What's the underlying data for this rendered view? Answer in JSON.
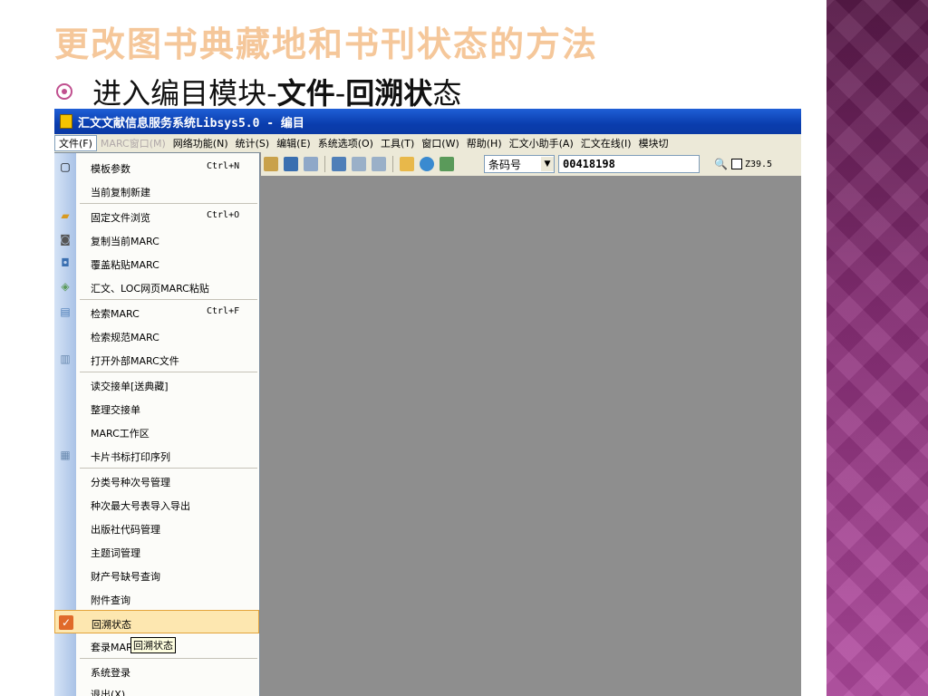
{
  "slide": {
    "title": "更改图书典藏地和书刊状态的方法",
    "bullet_prefix": "进入编目模块-",
    "bullet_bold1": "文件",
    "bullet_dash": "-",
    "bullet_bold2": "回溯状",
    "bullet_suffix": "态"
  },
  "window": {
    "title": "汇文文献信息服务系统Libsys5.0 - 编目"
  },
  "menubar": [
    "文件(F)",
    "MARC窗口(M)",
    "网络功能(N)",
    "统计(S)",
    "编辑(E)",
    "系统选项(O)",
    "工具(T)",
    "窗口(W)",
    "帮助(H)",
    "汇文小助手(A)",
    "汇文在线(I)",
    "模块切"
  ],
  "toolbar": {
    "search_type": "条码号",
    "search_value": "00418198",
    "z_label": "Z39.5"
  },
  "file_menu": [
    {
      "label": "模板参数",
      "shortcut": "Ctrl+N"
    },
    {
      "label": "当前复制新建",
      "shortcut": ""
    },
    {
      "label": "固定文件浏览",
      "shortcut": "Ctrl+O"
    },
    {
      "label": "复制当前MARC",
      "shortcut": ""
    },
    {
      "label": "覆盖粘贴MARC",
      "shortcut": ""
    },
    {
      "label": "汇文、LOC网页MARC粘贴",
      "shortcut": ""
    },
    {
      "label": "检索MARC",
      "shortcut": "Ctrl+F"
    },
    {
      "label": "检索规范MARC",
      "shortcut": ""
    },
    {
      "label": "打开外部MARC文件",
      "shortcut": ""
    },
    {
      "label": "读交接单[送典藏]",
      "shortcut": ""
    },
    {
      "label": "整理交接单",
      "shortcut": ""
    },
    {
      "label": "MARC工作区",
      "shortcut": ""
    },
    {
      "label": "卡片书标打印序列",
      "shortcut": ""
    },
    {
      "label": "分类号种次号管理",
      "shortcut": ""
    },
    {
      "label": "种次最大号表导入导出",
      "shortcut": ""
    },
    {
      "label": "出版社代码管理",
      "shortcut": ""
    },
    {
      "label": "主题词管理",
      "shortcut": ""
    },
    {
      "label": "财产号缺号查询",
      "shortcut": ""
    },
    {
      "label": "附件查询",
      "shortcut": ""
    },
    {
      "label": "回溯状态",
      "shortcut": ""
    },
    {
      "label": "套录MAR",
      "shortcut": ""
    },
    {
      "label": "系统登录",
      "shortcut": ""
    },
    {
      "label": "退出(X)",
      "shortcut": ""
    }
  ],
  "tooltip": "回溯状态",
  "icons": {
    "deco_band": "#8a2f78",
    "title_color": "#f5c79a",
    "highlight_color": "#fde7b0"
  }
}
